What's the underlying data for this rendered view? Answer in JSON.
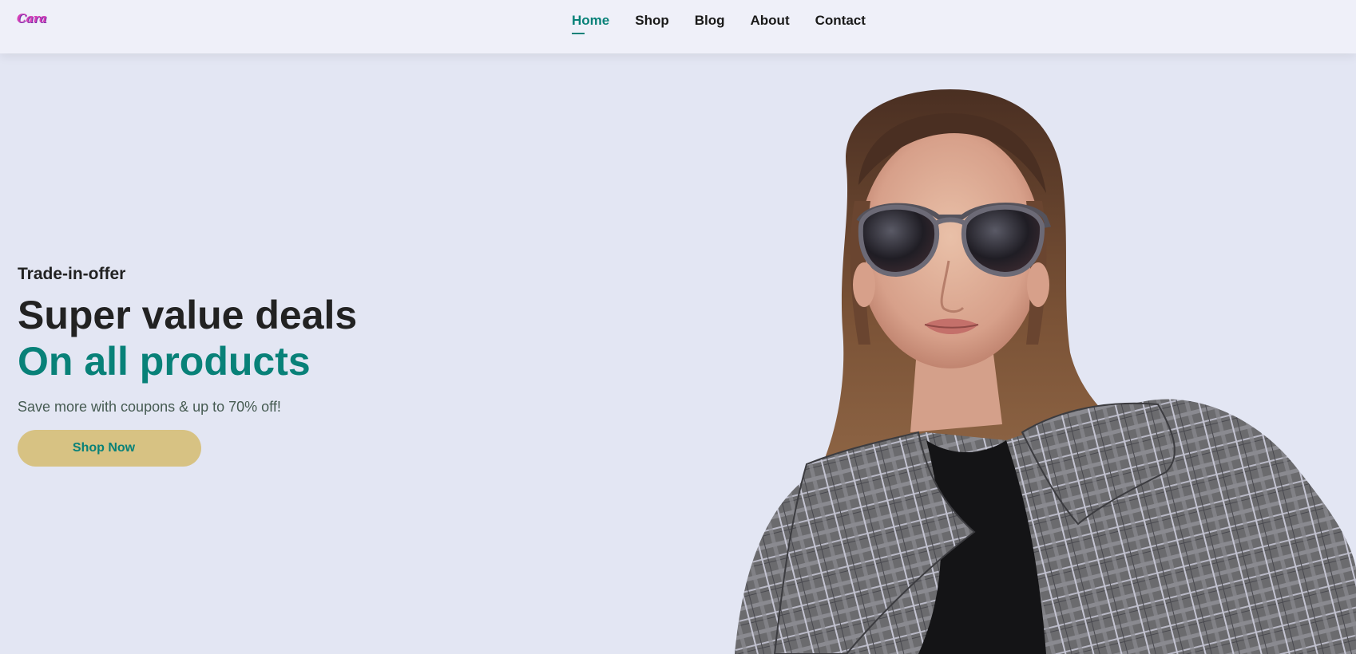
{
  "header": {
    "logo_text": "Cara",
    "nav": [
      {
        "label": "Home",
        "active": true
      },
      {
        "label": "Shop",
        "active": false
      },
      {
        "label": "Blog",
        "active": false
      },
      {
        "label": "About",
        "active": false
      },
      {
        "label": "Contact",
        "active": false
      }
    ]
  },
  "hero": {
    "eyebrow": "Trade-in-offer",
    "headline_line1": "Super value deals",
    "headline_line2": "On all products",
    "subtext": "Save more with coupons & up to 70% off!",
    "cta_label": "Shop Now",
    "image_subject": "woman-in-sunglasses-and-plaid-coat"
  },
  "colors": {
    "accent": "#088178",
    "background": "#e3e6f3",
    "header_bg": "#eff0f9",
    "button_bg": "#d7c283",
    "logo": "#d43fb8"
  }
}
